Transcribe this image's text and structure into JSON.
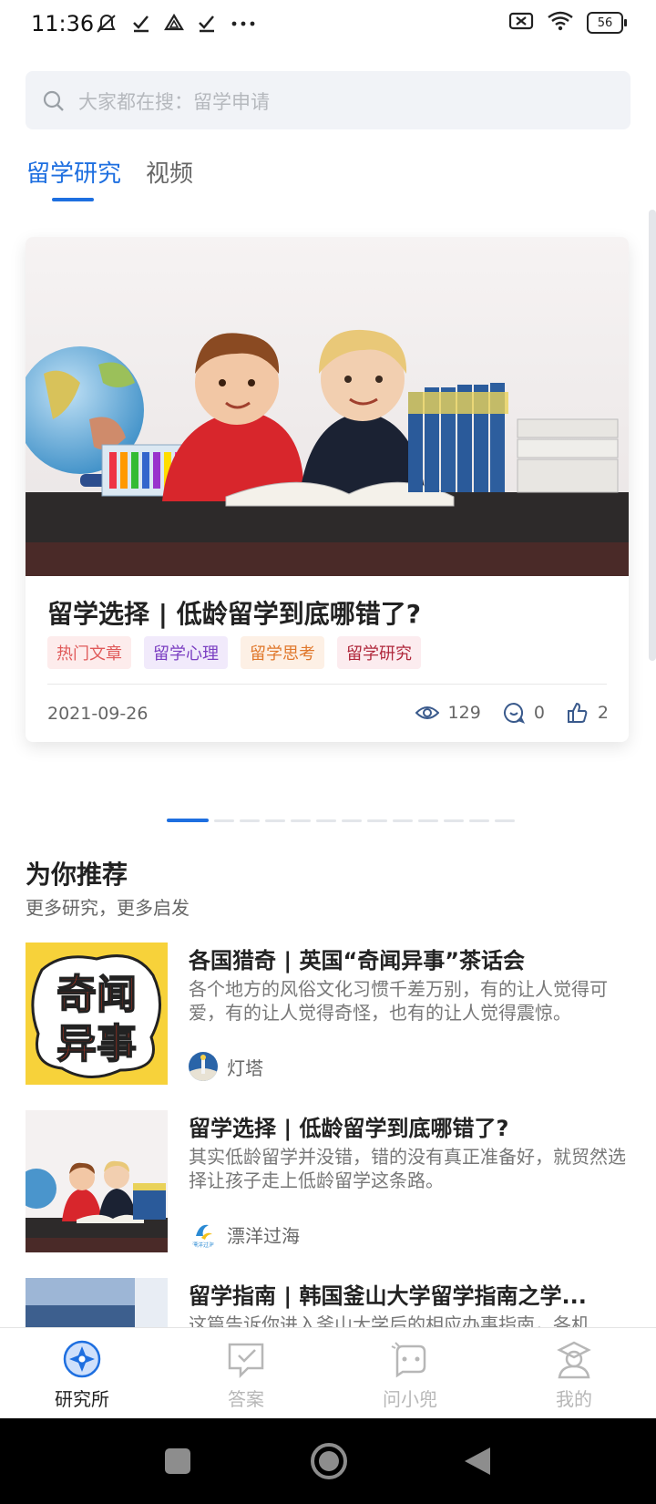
{
  "status_bar": {
    "time": "11:36",
    "icons": [
      "mute-icon",
      "check-icon",
      "drive-icon",
      "check-icon",
      "more-icon"
    ],
    "battery": "56"
  },
  "search": {
    "placeholder": "大家都在搜：留学申请"
  },
  "tabs": [
    {
      "label": "留学研究",
      "active": true
    },
    {
      "label": "视频",
      "active": false
    }
  ],
  "carousel": {
    "title": "留学选择 | 低龄留学到底哪错了?",
    "tags": [
      "热门文章",
      "留学心理",
      "留学思考",
      "留学研究"
    ],
    "date": "2021-09-26",
    "views": "129",
    "comments": "0",
    "likes": "2",
    "page_count": 13,
    "active_page": 1
  },
  "recommend": {
    "title": "为你推荐",
    "subtitle": "更多研究，更多启发",
    "items": [
      {
        "title": "各国猎奇 | 英国“奇闻异事”茶话会",
        "desc": "各个地方的风俗文化习惯千差万别，有的让人觉得可爱，有的让人觉得奇怪，也有的让人觉得震惊。",
        "author": "灯塔",
        "thumb_text_1": "奇闻",
        "thumb_text_2": "异事"
      },
      {
        "title": "留学选择 | 低龄留学到底哪错了?",
        "desc": "其实低龄留学并没错，错的没有真正准备好，就贸然选择让孩子走上低龄留学这条路。",
        "author": "漂洋过海",
        "avatar_text": "漂洋过海"
      },
      {
        "title": "留学指南 | 韩国釜山大学留学指南之学...",
        "desc": "这篇告诉你进入釜山大学后的相应办事指南，各机"
      }
    ]
  },
  "bottom_nav": [
    {
      "label": "研究所",
      "icon": "compass-icon",
      "active": true
    },
    {
      "label": "答案",
      "icon": "answer-icon",
      "active": false
    },
    {
      "label": "问小兜",
      "icon": "chat-bot-icon",
      "active": false
    },
    {
      "label": "我的",
      "icon": "profile-icon",
      "active": false
    }
  ],
  "colors": {
    "accent": "#1e6fe0"
  }
}
